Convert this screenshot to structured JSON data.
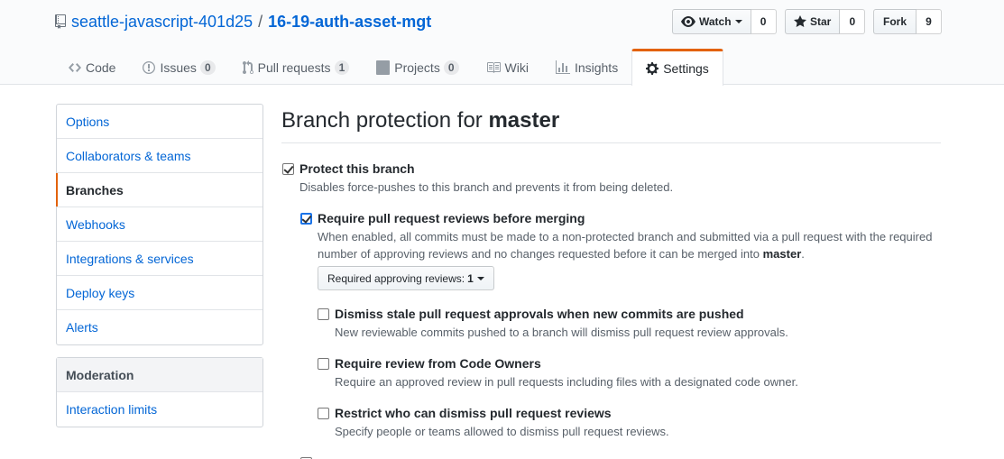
{
  "repo": {
    "owner": "seattle-javascript-401d25",
    "separator": "/",
    "name": "16-19-auth-asset-mgt"
  },
  "actions": {
    "watch": {
      "label": "Watch",
      "count": "0"
    },
    "star": {
      "label": "Star",
      "count": "0"
    },
    "fork": {
      "label": "Fork",
      "count": "9"
    }
  },
  "tabs": [
    {
      "label": "Code",
      "icon": "code-icon"
    },
    {
      "label": "Issues",
      "badge": "0",
      "icon": "issue-icon"
    },
    {
      "label": "Pull requests",
      "badge": "1",
      "icon": "pull-request-icon"
    },
    {
      "label": "Projects",
      "badge": "0",
      "icon": "project-icon"
    },
    {
      "label": "Wiki",
      "icon": "book-icon"
    },
    {
      "label": "Insights",
      "icon": "graph-icon"
    },
    {
      "label": "Settings",
      "icon": "gear-icon",
      "selected": true
    }
  ],
  "sidebar": {
    "items": [
      {
        "label": "Options"
      },
      {
        "label": "Collaborators & teams"
      },
      {
        "label": "Branches",
        "selected": true
      },
      {
        "label": "Webhooks"
      },
      {
        "label": "Integrations & services"
      },
      {
        "label": "Deploy keys"
      },
      {
        "label": "Alerts"
      }
    ],
    "moderation": {
      "heading": "Moderation",
      "items": [
        {
          "label": "Interaction limits"
        }
      ]
    }
  },
  "main": {
    "title_prefix": "Branch protection for",
    "title_branch": "master",
    "protect": {
      "label": "Protect this branch",
      "note": "Disables force-pushes to this branch and prevents it from being deleted.",
      "checked": true
    },
    "require_reviews": {
      "label": "Require pull request reviews before merging",
      "note_1": "When enabled, all commits must be made to a non-protected branch and submitted via a pull request with the required",
      "note_2": "number of approving reviews and no changes requested before it can be merged into",
      "note_branch": "master",
      "note_end": ".",
      "checked": true
    },
    "approving_select": {
      "label": "Required approving reviews:",
      "value": "1"
    },
    "sub_options": [
      {
        "label": "Dismiss stale pull request approvals when new commits are pushed",
        "note": "New reviewable commits pushed to a branch will dismiss pull request review approvals.",
        "checked": false
      },
      {
        "label": "Require review from Code Owners",
        "note": "Require an approved review in pull requests including files with a designated code owner.",
        "checked": false
      },
      {
        "label": "Restrict who can dismiss pull request reviews",
        "note": "Specify people or teams allowed to dismiss pull request reviews.",
        "checked": false
      }
    ]
  },
  "colors": {
    "link": "#0366d6",
    "accent": "#e36209",
    "text": "#24292e",
    "muted": "#586069"
  }
}
